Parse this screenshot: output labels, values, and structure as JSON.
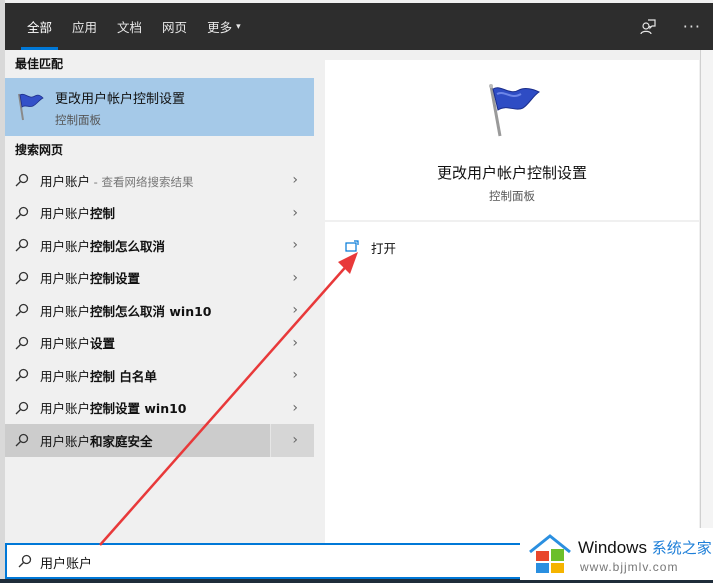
{
  "topbar": {
    "tabs": [
      {
        "label": "全部",
        "active": true
      },
      {
        "label": "应用",
        "active": false
      },
      {
        "label": "文档",
        "active": false
      },
      {
        "label": "网页",
        "active": false
      },
      {
        "label": "更多",
        "active": false,
        "dropdown": true
      }
    ],
    "feedback_icon": "feedback-person-icon",
    "more_icon": "ellipsis-icon",
    "more_glyph": "···",
    "caret_glyph": "▾"
  },
  "best_match": {
    "section_title": "最佳匹配",
    "title": "更改用户帐户控制设置",
    "subtitle": "控制面板",
    "icon": "blue-flag-icon"
  },
  "web_search": {
    "section_title": "搜索网页",
    "chevron_glyph": "›",
    "results": [
      {
        "query": "用户账户",
        "hint": " - 查看网络搜索结果",
        "suffix": ""
      },
      {
        "query": "用户账户",
        "bold": "控制",
        "suffix": ""
      },
      {
        "query": "用户账户",
        "bold": "控制怎么取消",
        "suffix": ""
      },
      {
        "query": "用户账户",
        "bold": "控制设置",
        "suffix": ""
      },
      {
        "query": "用户账户",
        "bold": "控制怎么取消 win10",
        "suffix": ""
      },
      {
        "query": "用户账户",
        "bold": "设置",
        "suffix": ""
      },
      {
        "query": "用户账户",
        "bold": "控制 白名单",
        "suffix": ""
      },
      {
        "query": "用户账户",
        "bold": "控制设置 win10",
        "suffix": ""
      },
      {
        "query": "用户账户",
        "bold": "和家庭安全",
        "suffix": "",
        "hovered": true
      }
    ]
  },
  "preview": {
    "title": "更改用户帐户控制设置",
    "subtitle": "控制面板",
    "actions": [
      {
        "label": "打开",
        "icon": "open-window-icon"
      }
    ]
  },
  "search": {
    "value": "用户账户",
    "placeholder": ""
  },
  "watermark": {
    "brand": "Windows",
    "brand_cn": "系统之家",
    "url": "www.bjjmlv.com"
  },
  "colors": {
    "accent": "#0078d7",
    "topbar": "#2d2d2d",
    "selected": "#a5c9e8",
    "hover": "#cccccc",
    "annotation": "#e8393a"
  }
}
